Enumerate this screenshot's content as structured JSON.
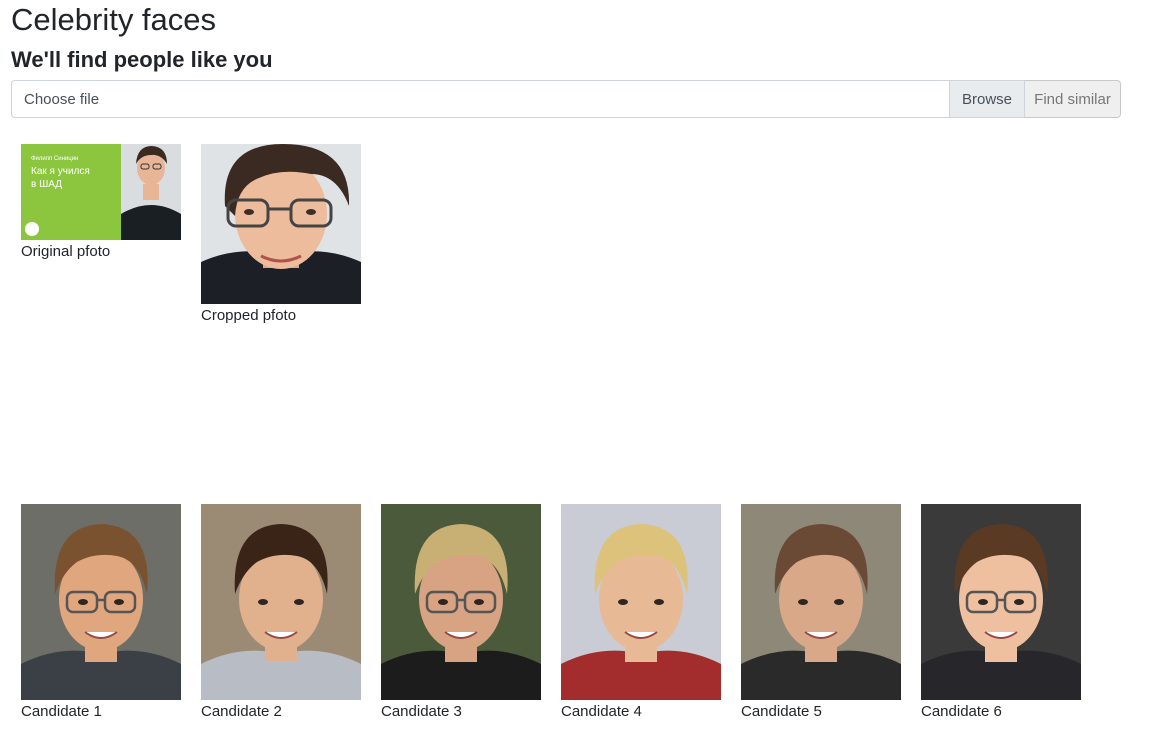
{
  "header": {
    "title": "Celebrity faces",
    "subtitle": "We'll find people like you"
  },
  "upload": {
    "placeholder": "Choose file",
    "browse_label": "Browse",
    "find_label": "Find similar"
  },
  "source_photos": {
    "original": {
      "caption": "Original pfoto",
      "banner_small": "Филипп Синицин",
      "banner_line1": "Как я учился",
      "banner_line2": "в ШАД",
      "banner_color": "#8cc63f"
    },
    "cropped": {
      "caption": "Cropped pfoto"
    }
  },
  "candidates": [
    {
      "caption": "Candidate 1",
      "hair": "#7a5230",
      "skin": "#e0a77f",
      "clothes": "#3b3f46",
      "bg": "#6d6e68",
      "glasses": true
    },
    {
      "caption": "Candidate 2",
      "hair": "#3a2418",
      "skin": "#e1b08d",
      "clothes": "#b8bcc4",
      "bg": "#9b8a74",
      "glasses": false
    },
    {
      "caption": "Candidate 3",
      "hair": "#c8b074",
      "skin": "#d7a383",
      "clothes": "#1c1c1c",
      "bg": "#4b5a3a",
      "glasses": true
    },
    {
      "caption": "Candidate 4",
      "hair": "#dcc27a",
      "skin": "#e8b995",
      "clothes": "#a32c2c",
      "bg": "#c9ccd4",
      "glasses": false
    },
    {
      "caption": "Candidate 5",
      "hair": "#6a4a35",
      "skin": "#d9a888",
      "clothes": "#2a2a2a",
      "bg": "#8e8878",
      "glasses": false
    },
    {
      "caption": "Candidate 6",
      "hair": "#5a3a22",
      "skin": "#efc0a0",
      "clothes": "#27272b",
      "bg": "#3a3a3a",
      "glasses": true
    }
  ]
}
